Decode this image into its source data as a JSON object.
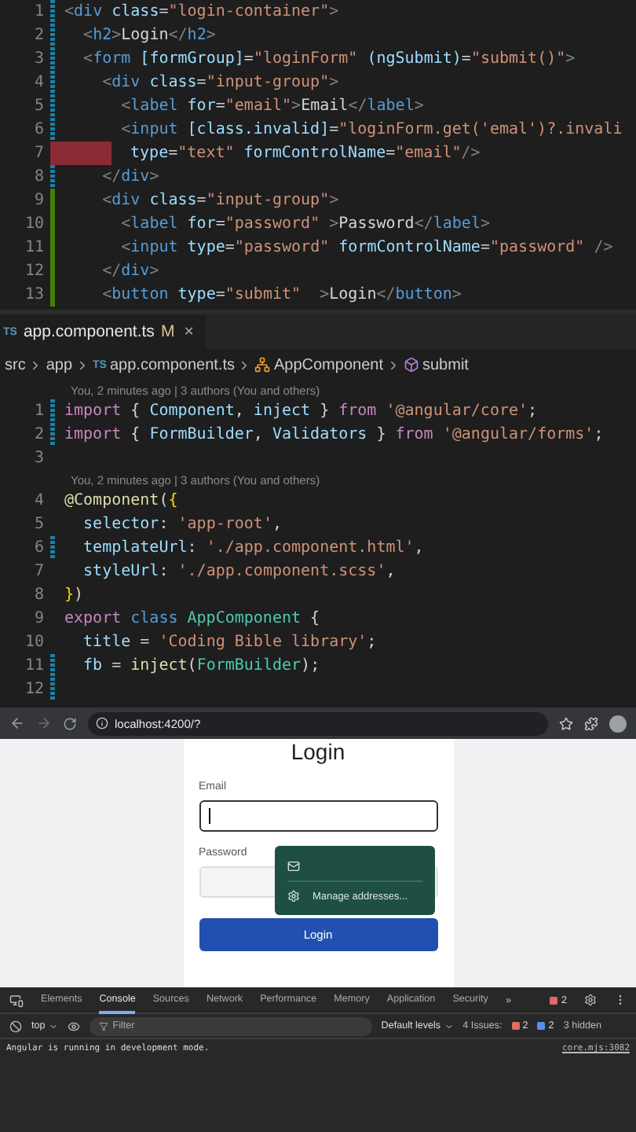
{
  "html_editor": {
    "lines": [
      {
        "number": "1",
        "modified": true,
        "added": false,
        "error": false,
        "tokens": [
          {
            "kind": "punct",
            "text": "<"
          },
          {
            "kind": "tag",
            "text": "div"
          },
          {
            "kind": "attr",
            "text": " class"
          },
          {
            "kind": "text",
            "text": "="
          },
          {
            "kind": "string",
            "text": "\"login-container\""
          },
          {
            "kind": "punct",
            "text": ">"
          }
        ]
      },
      {
        "number": "2",
        "modified": true,
        "added": false,
        "error": false,
        "tokens": [
          {
            "kind": "punct",
            "text": "  <"
          },
          {
            "kind": "tag",
            "text": "h2"
          },
          {
            "kind": "punct",
            "text": ">"
          },
          {
            "kind": "text",
            "text": "Login"
          },
          {
            "kind": "punct",
            "text": "</"
          },
          {
            "kind": "tag",
            "text": "h2"
          },
          {
            "kind": "punct",
            "text": ">"
          }
        ]
      },
      {
        "number": "3",
        "modified": true,
        "added": false,
        "error": false,
        "tokens": [
          {
            "kind": "punct",
            "text": "  <"
          },
          {
            "kind": "tag",
            "text": "form"
          },
          {
            "kind": "attr",
            "text": " [formGroup]"
          },
          {
            "kind": "text",
            "text": "="
          },
          {
            "kind": "string",
            "text": "\"loginForm\""
          },
          {
            "kind": "attr",
            "text": " (ngSubmit)"
          },
          {
            "kind": "text",
            "text": "="
          },
          {
            "kind": "string",
            "text": "\"submit()\""
          },
          {
            "kind": "punct",
            "text": ">"
          }
        ]
      },
      {
        "number": "4",
        "modified": true,
        "added": false,
        "error": false,
        "tokens": [
          {
            "kind": "punct",
            "text": "    <"
          },
          {
            "kind": "tag",
            "text": "div"
          },
          {
            "kind": "attr",
            "text": " class"
          },
          {
            "kind": "text",
            "text": "="
          },
          {
            "kind": "string",
            "text": "\"input-group\""
          },
          {
            "kind": "punct",
            "text": ">"
          }
        ]
      },
      {
        "number": "5",
        "modified": true,
        "added": false,
        "error": false,
        "tokens": [
          {
            "kind": "punct",
            "text": "      <"
          },
          {
            "kind": "tag",
            "text": "label"
          },
          {
            "kind": "attr",
            "text": " for"
          },
          {
            "kind": "text",
            "text": "="
          },
          {
            "kind": "string",
            "text": "\"email\""
          },
          {
            "kind": "punct",
            "text": ">"
          },
          {
            "kind": "text",
            "text": "Email"
          },
          {
            "kind": "punct",
            "text": "</"
          },
          {
            "kind": "tag",
            "text": "label"
          },
          {
            "kind": "punct",
            "text": ">"
          }
        ]
      },
      {
        "number": "6",
        "modified": true,
        "added": false,
        "error": false,
        "tokens": [
          {
            "kind": "punct",
            "text": "      <"
          },
          {
            "kind": "tag",
            "text": "input"
          },
          {
            "kind": "attr",
            "text": " [class.invalid]"
          },
          {
            "kind": "text",
            "text": "="
          },
          {
            "kind": "string",
            "text": "\"loginForm.get('emal')?.invali"
          }
        ]
      },
      {
        "number": "7",
        "modified": true,
        "added": false,
        "error": true,
        "tokens": [
          {
            "kind": "attr",
            "text": " type"
          },
          {
            "kind": "text",
            "text": "="
          },
          {
            "kind": "string",
            "text": "\"text\""
          },
          {
            "kind": "attr",
            "text": " formControlName"
          },
          {
            "kind": "text",
            "text": "="
          },
          {
            "kind": "string",
            "text": "\"email\""
          },
          {
            "kind": "punct",
            "text": "/>"
          }
        ]
      },
      {
        "number": "8",
        "modified": true,
        "added": false,
        "error": false,
        "tokens": [
          {
            "kind": "punct",
            "text": "    </"
          },
          {
            "kind": "tag",
            "text": "div"
          },
          {
            "kind": "punct",
            "text": ">"
          }
        ]
      },
      {
        "number": "9",
        "modified": false,
        "added": true,
        "error": false,
        "tokens": [
          {
            "kind": "punct",
            "text": "    <"
          },
          {
            "kind": "tag",
            "text": "div"
          },
          {
            "kind": "attr",
            "text": " class"
          },
          {
            "kind": "text",
            "text": "="
          },
          {
            "kind": "string",
            "text": "\"input-group\""
          },
          {
            "kind": "punct",
            "text": ">"
          }
        ]
      },
      {
        "number": "10",
        "modified": false,
        "added": true,
        "error": false,
        "tokens": [
          {
            "kind": "punct",
            "text": "      <"
          },
          {
            "kind": "tag",
            "text": "label"
          },
          {
            "kind": "attr",
            "text": " for"
          },
          {
            "kind": "text",
            "text": "="
          },
          {
            "kind": "string",
            "text": "\"password\""
          },
          {
            "kind": "punct",
            "text": " >"
          },
          {
            "kind": "text",
            "text": "Password"
          },
          {
            "kind": "punct",
            "text": "</"
          },
          {
            "kind": "tag",
            "text": "label"
          },
          {
            "kind": "punct",
            "text": ">"
          }
        ]
      },
      {
        "number": "11",
        "modified": false,
        "added": true,
        "error": false,
        "tokens": [
          {
            "kind": "punct",
            "text": "      <"
          },
          {
            "kind": "tag",
            "text": "input"
          },
          {
            "kind": "attr",
            "text": " type"
          },
          {
            "kind": "text",
            "text": "="
          },
          {
            "kind": "string",
            "text": "\"password\""
          },
          {
            "kind": "attr",
            "text": " formControlName"
          },
          {
            "kind": "text",
            "text": "="
          },
          {
            "kind": "string",
            "text": "\"password\""
          },
          {
            "kind": "punct",
            "text": " />"
          }
        ]
      },
      {
        "number": "12",
        "modified": false,
        "added": true,
        "error": false,
        "tokens": [
          {
            "kind": "punct",
            "text": "    </"
          },
          {
            "kind": "tag",
            "text": "div"
          },
          {
            "kind": "punct",
            "text": ">"
          }
        ]
      },
      {
        "number": "13",
        "modified": false,
        "added": true,
        "error": false,
        "tokens": [
          {
            "kind": "punct",
            "text": "    <"
          },
          {
            "kind": "tag",
            "text": "button"
          },
          {
            "kind": "attr",
            "text": " type"
          },
          {
            "kind": "text",
            "text": "="
          },
          {
            "kind": "string",
            "text": "\"submit\""
          },
          {
            "kind": "punct",
            "text": "  >"
          },
          {
            "kind": "text",
            "text": "Login"
          },
          {
            "kind": "punct",
            "text": "</"
          },
          {
            "kind": "tag",
            "text": "button"
          },
          {
            "kind": "punct",
            "text": ">"
          }
        ]
      }
    ]
  },
  "ts_editor": {
    "tab": {
      "badge": "TS",
      "label": "app.component.ts",
      "status": "M",
      "close": "×",
      "selected": true
    },
    "breadcrumb": [
      {
        "kind": "folder",
        "label": "src"
      },
      {
        "kind": "folder",
        "label": "app"
      },
      {
        "kind": "file",
        "badge": "TS",
        "label": "app.component.ts"
      },
      {
        "kind": "class",
        "label": "AppComponent"
      },
      {
        "kind": "method",
        "label": "submit"
      }
    ],
    "lines": [
      {
        "kind": "blame",
        "text": "You, 2 minutes ago | 3 authors (You and others)"
      },
      {
        "kind": "code",
        "number": "1",
        "modified": true,
        "tokens": [
          {
            "kind": "keyword",
            "text": "import"
          },
          {
            "kind": "text",
            "text": " { "
          },
          {
            "kind": "var",
            "text": "Component"
          },
          {
            "kind": "text",
            "text": ", "
          },
          {
            "kind": "var",
            "text": "inject"
          },
          {
            "kind": "text",
            "text": " } "
          },
          {
            "kind": "keyword",
            "text": "from"
          },
          {
            "kind": "string",
            "text": " '@angular/core'"
          },
          {
            "kind": "text",
            "text": ";"
          }
        ]
      },
      {
        "kind": "code",
        "number": "2",
        "modified": true,
        "tokens": [
          {
            "kind": "keyword",
            "text": "import"
          },
          {
            "kind": "text",
            "text": " { "
          },
          {
            "kind": "var",
            "text": "FormBuilder"
          },
          {
            "kind": "text",
            "text": ", "
          },
          {
            "kind": "var",
            "text": "Validators"
          },
          {
            "kind": "text",
            "text": " } "
          },
          {
            "kind": "keyword",
            "text": "from"
          },
          {
            "kind": "string",
            "text": " '@angular/forms'"
          },
          {
            "kind": "text",
            "text": ";"
          }
        ]
      },
      {
        "kind": "code",
        "number": "3",
        "modified": false
      },
      {
        "kind": "blame",
        "text": "You, 2 minutes ago | 3 authors (You and others)"
      },
      {
        "kind": "code",
        "number": "4",
        "modified": false,
        "tokens": [
          {
            "kind": "function",
            "text": "@Component"
          },
          {
            "kind": "text",
            "text": "("
          },
          {
            "kind": "brace",
            "text": "{"
          }
        ]
      },
      {
        "kind": "code",
        "number": "5",
        "modified": false,
        "tokens": [
          {
            "kind": "var",
            "text": "  selector"
          },
          {
            "kind": "text",
            "text": ": "
          },
          {
            "kind": "string",
            "text": "'app-root'"
          },
          {
            "kind": "text",
            "text": ","
          }
        ]
      },
      {
        "kind": "code",
        "number": "6",
        "modified": true,
        "tokens": [
          {
            "kind": "var",
            "text": "  templateUrl"
          },
          {
            "kind": "text",
            "text": ": "
          },
          {
            "kind": "string",
            "text": "'./app.component.html'"
          },
          {
            "kind": "text",
            "text": ","
          }
        ]
      },
      {
        "kind": "code",
        "number": "7",
        "modified": false,
        "tokens": [
          {
            "kind": "var",
            "text": "  styleUrl"
          },
          {
            "kind": "text",
            "text": ": "
          },
          {
            "kind": "string",
            "text": "'./app.component.scss'"
          },
          {
            "kind": "text",
            "text": ","
          }
        ]
      },
      {
        "kind": "code",
        "number": "8",
        "modified": false,
        "tokens": [
          {
            "kind": "brace",
            "text": "}"
          },
          {
            "kind": "text",
            "text": ")"
          }
        ]
      },
      {
        "kind": "code",
        "number": "9",
        "modified": false,
        "tokens": [
          {
            "kind": "keyword",
            "text": "export"
          },
          {
            "kind": "tag",
            "text": " class"
          },
          {
            "kind": "class",
            "text": " AppComponent"
          },
          {
            "kind": "text",
            "text": " {"
          }
        ]
      },
      {
        "kind": "code",
        "number": "10",
        "modified": false,
        "tokens": [
          {
            "kind": "var",
            "text": "  title"
          },
          {
            "kind": "text",
            "text": " = "
          },
          {
            "kind": "string",
            "text": "'Coding Bible library'"
          },
          {
            "kind": "text",
            "text": ";"
          }
        ]
      },
      {
        "kind": "code",
        "number": "11",
        "modified": true,
        "tokens": [
          {
            "kind": "var",
            "text": "  fb"
          },
          {
            "kind": "text",
            "text": " = "
          },
          {
            "kind": "function",
            "text": "inject"
          },
          {
            "kind": "text",
            "text": "("
          },
          {
            "kind": "class",
            "text": "FormBuilder"
          },
          {
            "kind": "text",
            "text": ");"
          }
        ]
      },
      {
        "kind": "code",
        "number": "12",
        "modified": true
      }
    ]
  },
  "browser": {
    "url": "localhost:4200/?"
  },
  "login_page": {
    "title": "Login",
    "email_label": "Email",
    "email_focused": true,
    "password_label": "Password",
    "button": "Login",
    "autofill_menu": {
      "items": [
        {
          "kind": "email"
        },
        {
          "kind": "manage",
          "label": "Manage addresses..."
        }
      ]
    }
  },
  "devtools": {
    "tabs": [
      {
        "label": "Elements",
        "selected": false
      },
      {
        "label": "Console",
        "selected": true
      },
      {
        "label": "Sources",
        "selected": false
      },
      {
        "label": "Network",
        "selected": false
      },
      {
        "label": "Performance",
        "selected": false
      },
      {
        "label": "Memory",
        "selected": false
      },
      {
        "label": "Application",
        "selected": false
      },
      {
        "label": "Security",
        "selected": false
      }
    ],
    "overflow": "»",
    "error_count": "2",
    "context": "top",
    "filter_placeholder": "Filter",
    "levels": "Default levels",
    "issues_label": "4 Issues:",
    "issue_errors": "2",
    "issue_infos": "2",
    "hidden": "3 hidden",
    "messages": [
      {
        "text": "Angular is running in development mode.",
        "source": "core.mjs:3082"
      }
    ]
  }
}
